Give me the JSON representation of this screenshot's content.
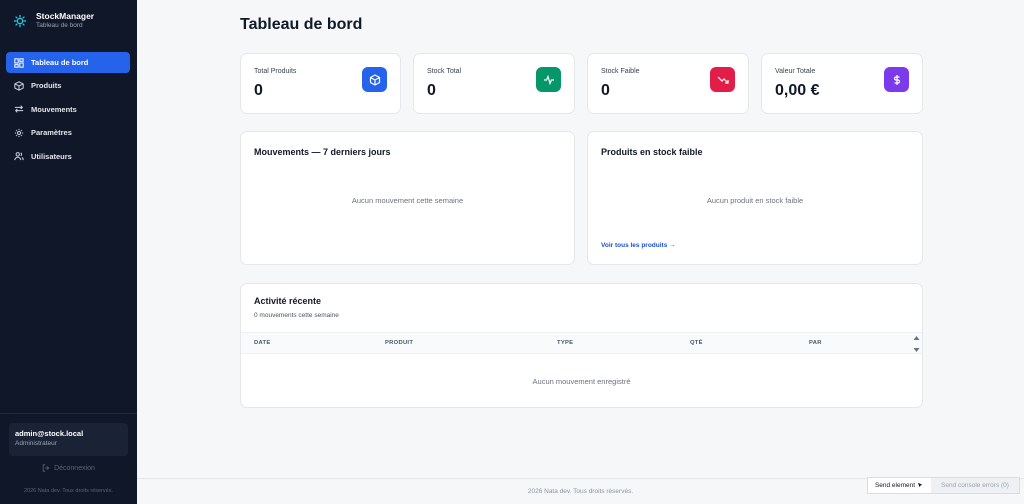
{
  "brand": {
    "title": "StockManager",
    "subtitle": "Tableau de bord"
  },
  "sidebar": {
    "items": [
      {
        "label": "Tableau de bord",
        "icon": "dashboard-icon",
        "active": true
      },
      {
        "label": "Produits",
        "icon": "box-icon"
      },
      {
        "label": "Mouvements",
        "icon": "arrows-exchange-icon"
      },
      {
        "label": "Paramètres",
        "icon": "gear-icon"
      },
      {
        "label": "Utilisateurs",
        "icon": "users-icon"
      }
    ],
    "user": {
      "email": "admin@stock.local",
      "role": "Administrateur"
    },
    "logout_label": "Déconnexion",
    "footer": "2026 Nata dev. Tous droits réservés."
  },
  "page": {
    "title": "Tableau de bord"
  },
  "stats": [
    {
      "label": "Total Produits",
      "value": "0",
      "icon": "cube-icon",
      "color": "#2563eb"
    },
    {
      "label": "Stock Total",
      "value": "0",
      "icon": "activity-icon",
      "color": "#059669"
    },
    {
      "label": "Stock Faible",
      "value": "0",
      "icon": "trending-down-icon",
      "color": "#e11d48"
    },
    {
      "label": "Valeur Totale",
      "value": "0,00 €",
      "icon": "dollar-icon",
      "color": "#7c3aed"
    }
  ],
  "movements_panel": {
    "title": "Mouvements — 7 derniers jours",
    "empty": "Aucun mouvement cette semaine"
  },
  "low_stock_panel": {
    "title": "Produits en stock faible",
    "empty": "Aucun produit en stock faible",
    "link": "Voir tous les produits →"
  },
  "activity": {
    "title": "Activité récente",
    "subtitle": "0 mouvements cette semaine",
    "columns": [
      "DATE",
      "PRODUIT",
      "TYPE",
      "QTÉ",
      "PAR"
    ],
    "empty": "Aucun mouvement enregistré"
  },
  "footer": {
    "text": "2026 Nata dev. Tous droits réservés."
  },
  "devtools": {
    "send_element": "Send element",
    "send_console": "Send console errors (0)"
  }
}
